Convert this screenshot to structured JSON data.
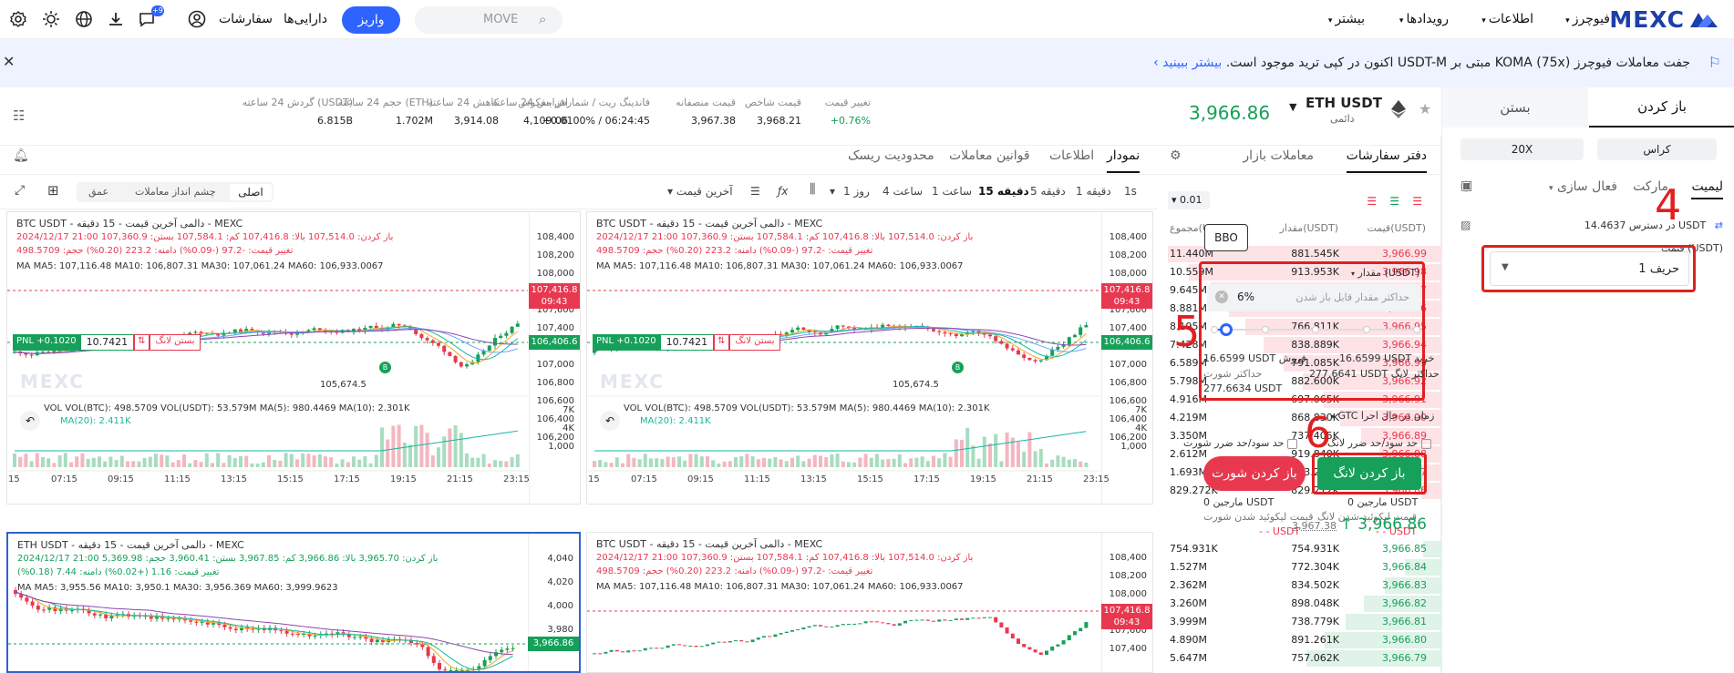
{
  "nav": {
    "brand": "MEXC",
    "futures": "فیوچرز",
    "info": "اطلاعات",
    "events": "رویدادها",
    "more": "بیشتر",
    "assets": "دارایی‌ها",
    "orders": "سفارشات",
    "deposit": "واریز",
    "search_value": "MOVE",
    "notify_count": "+9",
    "icons": [
      "settings-icon",
      "theme-icon",
      "globe-icon",
      "download-icon",
      "chat-icon",
      "user-icon",
      "search-icon"
    ]
  },
  "announcement": {
    "text": "جفت معاملات فیوچرز KOMA (75x) مبتی بر USDT-M اکنون در کپی ترید موجود است.",
    "link": "بیشتر ببینید"
  },
  "ticker": {
    "symbol": "ETH USDT",
    "subtitle": "دائمی",
    "price": "3,966.86",
    "stats": [
      {
        "label": "تغییر قیمت",
        "value": "+0.76%"
      },
      {
        "label": "قیمت شاخص",
        "value": "3,968.21"
      },
      {
        "label": "قیمت منصفانه",
        "value": "3,967.38"
      },
      {
        "label": "فاندینگ ریت / شمارش معکوس",
        "value": "+0.0100% / 06:24:45"
      },
      {
        "label": "افزایش 24 ساعته",
        "value": "4,109.06"
      },
      {
        "label": "کاهش 24 ساعته",
        "value": "3,914.08"
      },
      {
        "label": "حجم 24 ساعته (ETH)",
        "value": "1.702M"
      },
      {
        "label": "گردش 24 ساعته (USDT)",
        "value": "6.815B"
      }
    ]
  },
  "order_panel": {
    "tab_open": "باز کردن",
    "tab_close": "بستن",
    "margin_mode": "کراس",
    "leverage": "20X",
    "types": [
      "لیمیت",
      "مارکت",
      "فعال سازی"
    ],
    "available_label": "در دسترس",
    "available_value": "14.4637 USDT",
    "price_label": "قیمت (USDT)",
    "price_value": "حریف 1",
    "bbo": "BBO",
    "amount_label": "مقدار (USDT)",
    "amount_placeholder": "حداکثر مقدار قابل باز شدن",
    "amount_percent": "6%",
    "slider_fraction": 0.06,
    "buy_label": "خرید",
    "buy_value": "16.6599 USDT",
    "sell_label": "فروش",
    "sell_value": "16.6599 USDT",
    "max_long_label": "حداکثر لانگ",
    "max_long_value": "277.6641 USDT",
    "max_short_label": "حداکثر شورت",
    "max_short_value": "277.6634 USDT",
    "tif_label": "زمان در حال اجرا",
    "tif_value": "GTC",
    "tpsl_long": "حد سود/حد ضرر لانگ",
    "tpsl_short": "حد سود/حد ضرر شورت",
    "open_long": "باز کردن لانگ",
    "open_short": "باز کردن شورت",
    "margin_label": "مارجین",
    "margin_long": "0 USDT",
    "margin_short": "0 USDT",
    "liq_long_label": "قیمت لیکوئید شدن لانگ",
    "liq_short_label": "قیمت لیکوئید شدن شورت",
    "liq_long": "- - USDT",
    "liq_short": "- - USDT",
    "annotations": [
      "4",
      "5",
      "6"
    ]
  },
  "order_book": {
    "tab_book": "دفتر سفارشات",
    "tab_trades": "معاملات بازار",
    "precision": "0.01",
    "col_price": "قیمت(USDT)",
    "col_amount": "مقدار(USDT)",
    "col_total": "مجموع(USDT)",
    "asks": [
      [
        "3,966.99",
        "881.545K",
        "11.440M"
      ],
      [
        "3,966.98",
        "913.953K",
        "10.559M"
      ],
      [
        "3,966.97",
        "763.681K",
        "9.645M"
      ],
      [
        "3,966.96",
        "686.125K",
        "8.881M"
      ],
      [
        "3,966.95",
        "766.811K",
        "8.195M"
      ],
      [
        "3,966.94",
        "838.889K",
        "7.428M"
      ],
      [
        "3,966.93",
        "791.085K",
        "6.589M"
      ],
      [
        "3,966.92",
        "882.600K",
        "5.798M"
      ],
      [
        "3,966.91",
        "697.065K",
        "4.916M"
      ],
      [
        "3,966.90",
        "868.830K",
        "4.219M"
      ],
      [
        "3,966.89",
        "737.405K",
        "3.350M"
      ],
      [
        "3,966.88",
        "919.840K",
        "2.612M"
      ],
      [
        "3,966.87",
        "863.231K",
        "1.693M"
      ],
      [
        "3,966.86",
        "829.272K",
        "829.272K"
      ]
    ],
    "last_price": "3,966.86",
    "mark_price": "3,967.38",
    "bids": [
      [
        "3,966.85",
        "754.931K",
        "754.931K"
      ],
      [
        "3,966.84",
        "772.304K",
        "1.527M"
      ],
      [
        "3,966.83",
        "834.502K",
        "2.362M"
      ],
      [
        "3,966.82",
        "898.048K",
        "3.260M"
      ],
      [
        "3,966.81",
        "738.779K",
        "3.999M"
      ],
      [
        "3,966.80",
        "891.261K",
        "4.890M"
      ],
      [
        "3,966.79",
        "757.062K",
        "5.647M"
      ]
    ]
  },
  "chart_header": {
    "tabs": [
      "نمودار",
      "اطلاعات",
      "قوانین معاملات",
      "محدودیت ریسک"
    ],
    "timeframes": [
      "1s",
      "1 دقیقه",
      "5 دقیقه",
      "15 دقیقه",
      "1 ساعت",
      "4 ساعت",
      "1 روز"
    ],
    "active_tf": "15 دقیقه",
    "price_type": "آخرین قیمت",
    "views": [
      "اصلی",
      "چشم انداز معاملات",
      "عمق"
    ]
  },
  "panes": [
    {
      "title": "BTC USDT - دالمی آخرین قیمت - 15 دقیقه - MEXC",
      "line1": "2024/12/17 21:00  باز کردن: 107,514.0  بالا: 107,416.8  کم: 107,584.1  بستن: 107,360.9",
      "line2": "تغییر قیمت: -97.2 (-0.09%)  دامنه: 223.2 (0.20%)  حجم: 498.5709",
      "ma": "MA  MA5: 107,116.48  MA10: 106,807.31  MA30: 107,061.24  MA60: 106,933.0067",
      "axis": [
        "108,400",
        "108,200",
        "108,000",
        "107,800",
        "107,600",
        "107,400",
        "107,200",
        "107,000",
        "106,800",
        "106,600",
        "106,400",
        "106,200"
      ],
      "last_tag": "107,416.8",
      "countdown": "09:43",
      "pos_tag": "106,406.6",
      "pnl": "PNL +0.1020",
      "entry": "10.7421",
      "close_long": "بستن لانگ",
      "low_label": "105,674.5",
      "vol": "VOL  VOL(BTC): 498.5709  VOL(USDT): 53.579M  MA(5): 980.4469  MA(10): 2.301K",
      "vol2": "MA(20): 2.411K",
      "vol_axis": [
        "7K",
        "4K",
        "1,000"
      ],
      "times": [
        "15",
        "07:15",
        "09:15",
        "11:15",
        "13:15",
        "15:15",
        "17:15",
        "19:15",
        "21:15",
        "23:15"
      ]
    },
    {
      "title": "ETH USDT - دالمی آخرین قیمت - 15 دقیقه - MEXC",
      "line1": "2024/12/17 21:00  باز کردن: 3,965.70  بالا: 3,966.86  کم: 3,967.85  بستن: 3,960.41  حجم: 5,369.98",
      "line2": "تغییر قیمت: 1.16 (+0.02%)  دامنه: 7.44 (0.18%)",
      "ma": "MA  MA5: 3,955.56  MA10: 3,950.1  MA30: 3,956.369  MA60: 3,999.9623",
      "axis": [
        "4,040",
        "4,020",
        "4,000",
        "3,980"
      ],
      "last_tag": "3,966.86"
    }
  ],
  "chart_data": [
    {
      "type": "line",
      "title": "BTC USDT - دالمی آخرین قیمت - 15 دقیقه - MEXC",
      "x": [
        "07:15",
        "09:15",
        "11:15",
        "13:15",
        "15:15",
        "17:15",
        "19:15",
        "21:15"
      ],
      "series": [
        {
          "name": "MA5",
          "values": [
            106200,
            106350,
            106700,
            107000,
            107100,
            107450,
            106900,
            107116
          ]
        }
      ],
      "ylim": [
        105600,
        108400
      ]
    },
    {
      "type": "line",
      "title": "ETH USDT - دالمی آخرین قیمت - 15 دقیقه - MEXC",
      "x": [
        "07:15",
        "09:15",
        "11:15",
        "13:15",
        "15:15",
        "17:15",
        "19:15",
        "21:15"
      ],
      "series": [
        {
          "name": "MA5",
          "values": [
            3990,
            3985,
            3978,
            3970,
            3962,
            3958,
            3950,
            3955
          ]
        }
      ],
      "ylim": [
        3960,
        4050
      ]
    }
  ]
}
